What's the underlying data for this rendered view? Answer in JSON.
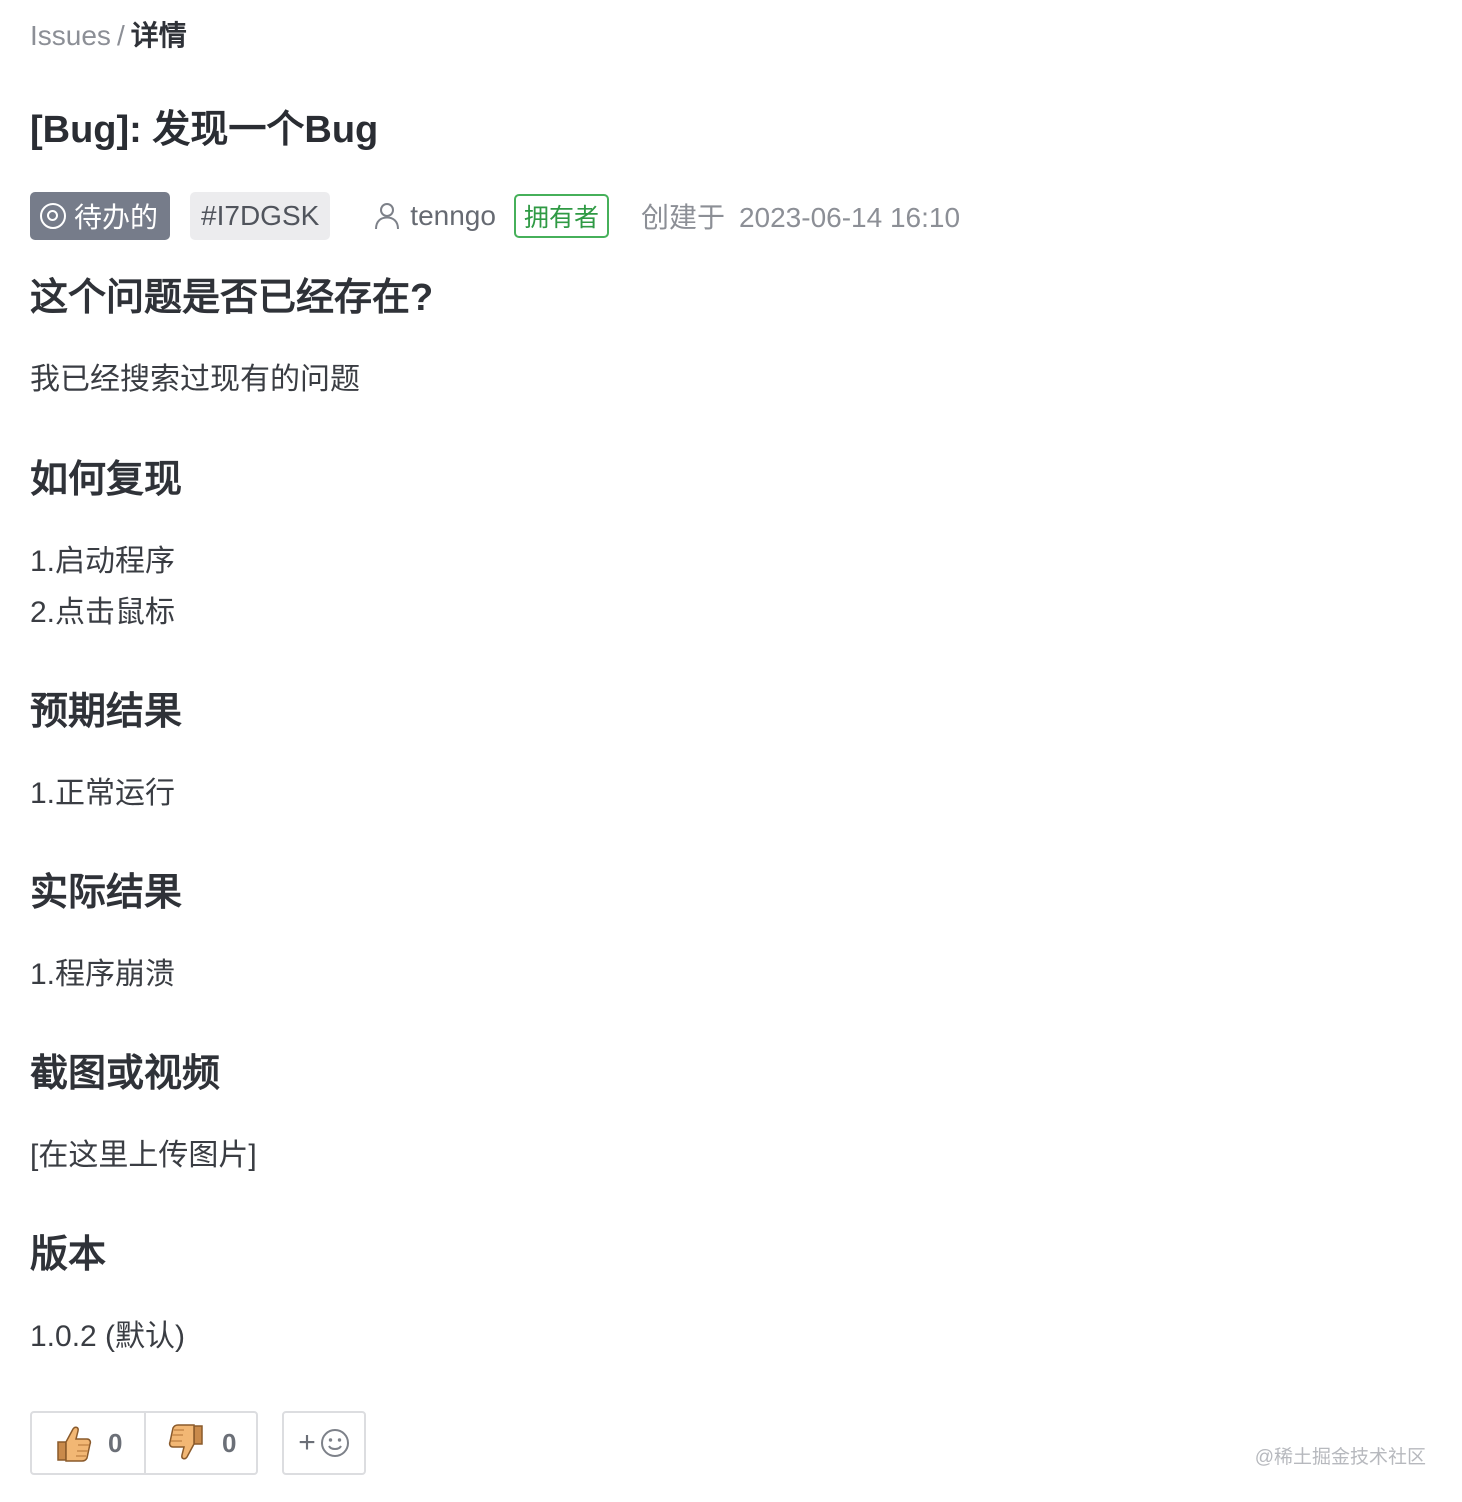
{
  "breadcrumb": {
    "parent": "Issues",
    "separator": "/",
    "current": "详情"
  },
  "issue": {
    "title": "[Bug]: 发现一个Bug",
    "state": "待办的",
    "id": "#I7DGSK",
    "author": "tenngo",
    "author_role": "拥有者",
    "created_label": "创建于",
    "created_at": "2023-06-14 16:10"
  },
  "sections": [
    {
      "heading": "这个问题是否已经存在?",
      "lines": [
        "我已经搜索过现有的问题"
      ]
    },
    {
      "heading": "如何复现",
      "lines": [
        "1.启动程序",
        "2.点击鼠标"
      ]
    },
    {
      "heading": "预期结果",
      "lines": [
        "1.正常运行"
      ]
    },
    {
      "heading": "实际结果",
      "lines": [
        "1.程序崩溃"
      ]
    },
    {
      "heading": "截图或视频",
      "lines": [
        "[在这里上传图片]"
      ]
    },
    {
      "heading": "版本",
      "lines": [
        "1.0.2 (默认)"
      ]
    }
  ],
  "reactions": {
    "thumbs_up": {
      "icon": "thumbs-up-icon",
      "count": "0"
    },
    "thumbs_down": {
      "icon": "thumbs-down-icon",
      "count": "0"
    },
    "add": {
      "icon": "add-emoji-icon",
      "label": "+"
    }
  },
  "watermark": "@稀土掘金技术社区",
  "colors": {
    "state_badge": "#767c8a",
    "owner_tag": "#46b05a"
  }
}
